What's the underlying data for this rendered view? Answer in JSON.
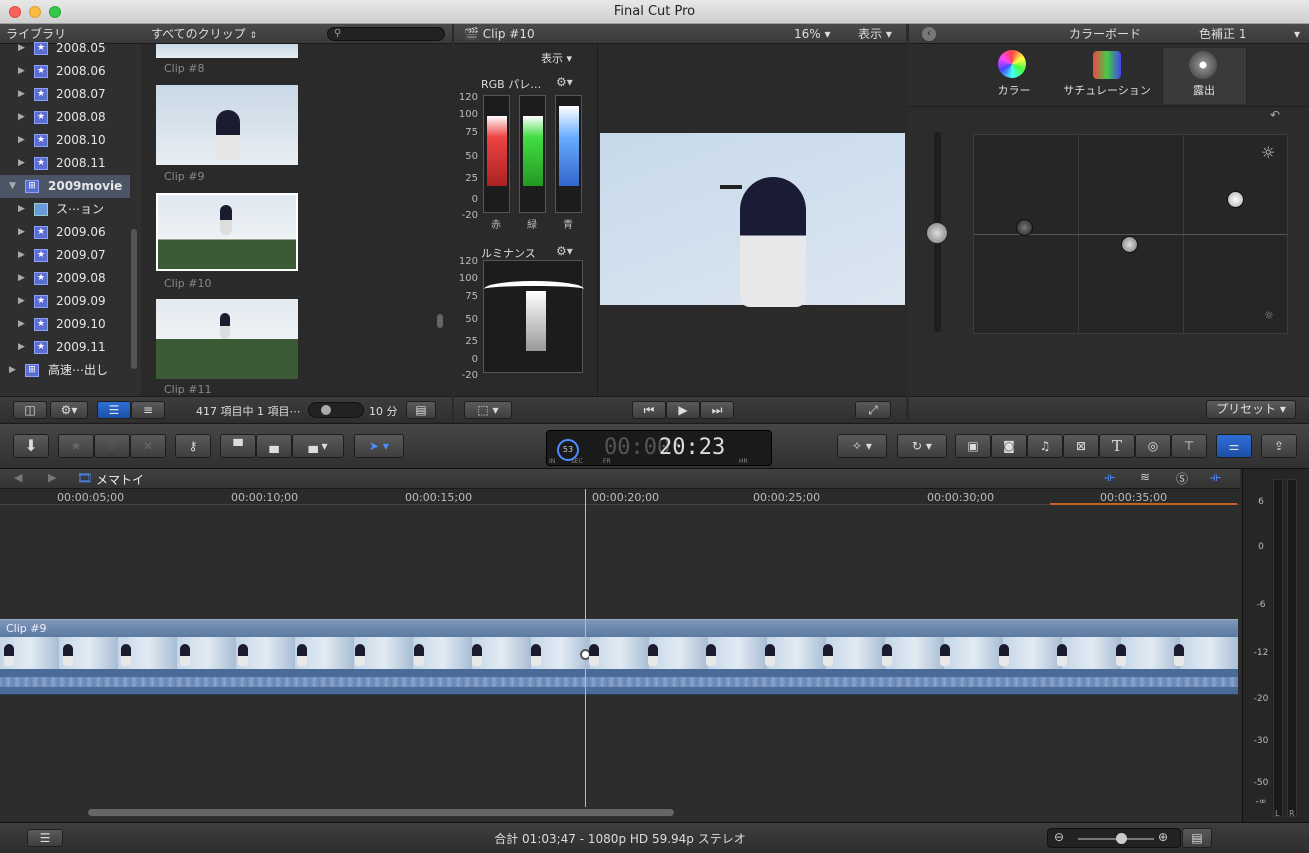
{
  "app": {
    "title": "Final Cut Pro"
  },
  "library": {
    "header": "ライブラリ",
    "items": [
      {
        "label": "2008.05",
        "icon": "event-star-icon"
      },
      {
        "label": "2008.06",
        "icon": "event-star-icon"
      },
      {
        "label": "2008.07",
        "icon": "event-star-icon"
      },
      {
        "label": "2008.08",
        "icon": "event-star-icon"
      },
      {
        "label": "2008.10",
        "icon": "event-star-icon"
      },
      {
        "label": "2008.11",
        "icon": "event-star-icon"
      },
      {
        "label": "2009movie",
        "icon": "library-icon"
      },
      {
        "label": "ス⋯ョン",
        "icon": "folder-icon"
      },
      {
        "label": "2009.06",
        "icon": "event-star-icon"
      },
      {
        "label": "2009.07",
        "icon": "event-star-icon"
      },
      {
        "label": "2009.08",
        "icon": "event-star-icon"
      },
      {
        "label": "2009.09",
        "icon": "event-star-icon"
      },
      {
        "label": "2009.10",
        "icon": "event-star-icon"
      },
      {
        "label": "2009.11",
        "icon": "event-star-icon"
      },
      {
        "label": "高速⋯出し",
        "icon": "library-icon"
      }
    ]
  },
  "browser": {
    "filter": "すべてのクリップ",
    "clips": [
      "Clip #8",
      "Clip #9",
      "Clip #10",
      "Clip #11"
    ],
    "status": "417 項目中 1 項目⋯",
    "duration": "10 分"
  },
  "viewer": {
    "clip": "Clip #10",
    "zoom": "16%",
    "view": "表示",
    "scope_view": "表示",
    "rgb_title": "RGB パレ…",
    "luma_title": "ルミナンス",
    "scale": [
      "120",
      "100",
      "75",
      "50",
      "25",
      "0",
      "-20"
    ],
    "channels": [
      "赤",
      "緑",
      "青"
    ]
  },
  "inspector": {
    "board": "カラーボード",
    "correction": "色補正 1",
    "tabs": [
      "カラー",
      "サチュレーション",
      "露出"
    ],
    "preset": "プリセット"
  },
  "toolbar": {
    "timecode": "20:23",
    "timecode_dim": "00:00:",
    "tc_small": "53",
    "tc_units": [
      "IN",
      "SEC",
      "FR",
      "HR"
    ]
  },
  "timeline": {
    "project": "メマトイ",
    "ruler": [
      "00:00:05;00",
      "00:00:10;00",
      "00:00:15;00",
      "00:00:20;00",
      "00:00:25;00",
      "00:00:30;00",
      "00:00:35;00"
    ],
    "clip": "Clip #9"
  },
  "meter": {
    "scale": [
      "6",
      "0",
      "-6",
      "-12",
      "-20",
      "-30",
      "-50",
      "-∞"
    ],
    "channels": [
      "L",
      "R"
    ]
  },
  "status": {
    "text": "合計 01:03;47 - 1080p HD 59.94p ステレオ"
  }
}
